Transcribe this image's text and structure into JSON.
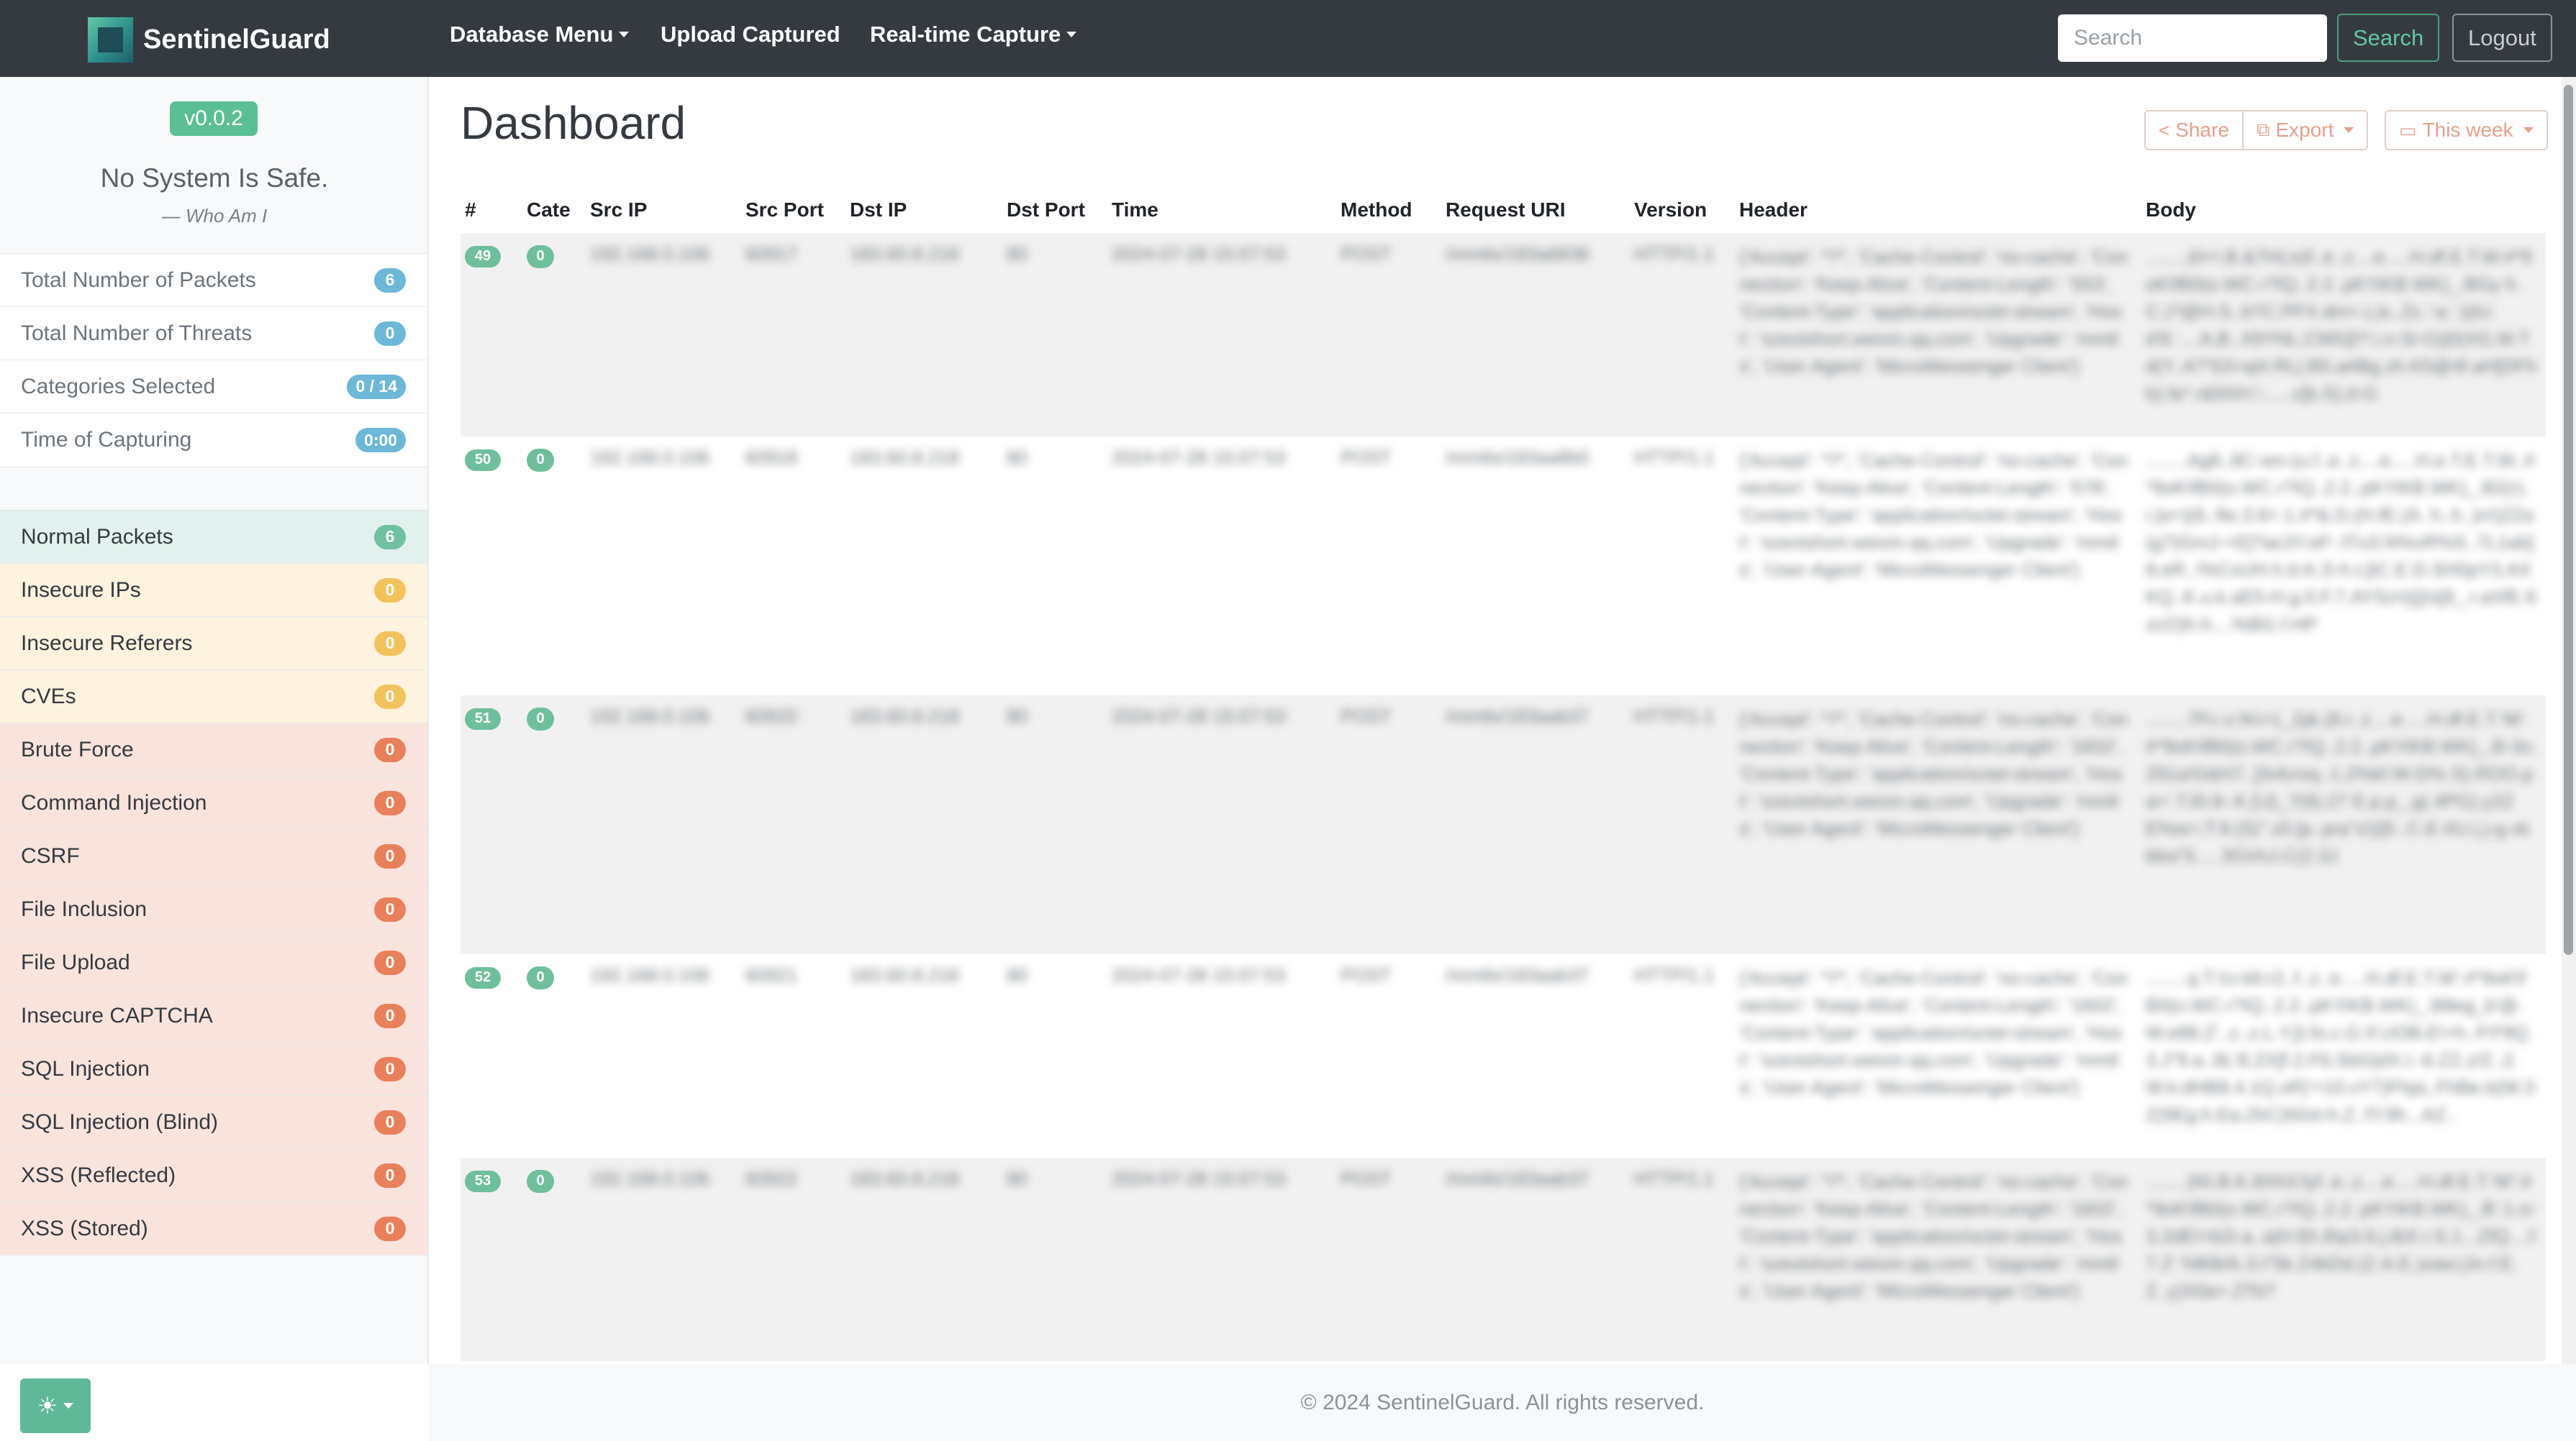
{
  "navbar": {
    "brand": "SentinelGuard",
    "menus": [
      {
        "label": "Database Menu",
        "dropdown": true
      },
      {
        "label": "Upload Captured",
        "dropdown": false
      },
      {
        "label": "Real-time Capture",
        "dropdown": true
      }
    ],
    "search_placeholder": "Search",
    "search_button": "Search",
    "logout_button": "Logout"
  },
  "sidebar": {
    "version": "v0.0.2",
    "motto": "No System Is Safe.",
    "motto_by": "— Who Am I",
    "stats": [
      {
        "label": "Total Number of Packets",
        "value": "6"
      },
      {
        "label": "Total Number of Threats",
        "value": "0"
      },
      {
        "label": "Categories Selected",
        "value": "0 / 14"
      },
      {
        "label": "Time of Capturing",
        "value": "0:00"
      }
    ],
    "categories": [
      {
        "label": "Normal Packets",
        "value": "6",
        "level": "safe"
      },
      {
        "label": "Insecure IPs",
        "value": "0",
        "level": "warn"
      },
      {
        "label": "Insecure Referers",
        "value": "0",
        "level": "warn"
      },
      {
        "label": "CVEs",
        "value": "0",
        "level": "warn"
      },
      {
        "label": "Brute Force",
        "value": "0",
        "level": "danger"
      },
      {
        "label": "Command Injection",
        "value": "0",
        "level": "danger"
      },
      {
        "label": "CSRF",
        "value": "0",
        "level": "danger"
      },
      {
        "label": "File Inclusion",
        "value": "0",
        "level": "danger"
      },
      {
        "label": "File Upload",
        "value": "0",
        "level": "danger"
      },
      {
        "label": "Insecure CAPTCHA",
        "value": "0",
        "level": "danger"
      },
      {
        "label": "SQL Injection",
        "value": "0",
        "level": "danger"
      },
      {
        "label": "SQL Injection (Blind)",
        "value": "0",
        "level": "danger"
      },
      {
        "label": "XSS (Reflected)",
        "value": "0",
        "level": "danger"
      },
      {
        "label": "XSS (Stored)",
        "value": "0",
        "level": "danger"
      }
    ],
    "theme_icon": "sun-icon"
  },
  "main": {
    "title": "Dashboard",
    "share_label": "Share",
    "export_label": "Export",
    "range_label": "This week",
    "columns": [
      "#",
      "Cate",
      "Src IP",
      "Src Port",
      "Dst IP",
      "Dst Port",
      "Time",
      "Method",
      "Request URI",
      "Version",
      "Header",
      "Body"
    ],
    "rows": [
      {
        "num": "49",
        "cate": "0",
        "src_ip": "192.168.0.106",
        "src_port": "60917",
        "dst_ip": "183.60.8.218",
        "dst_port": "80",
        "time": "2024-07-28 15:07:53",
        "method": "POST",
        "uri": "/mmtls/183a6838",
        "version": "HTTP/1.1",
        "header": "{'Accept': '*/*', 'Cache-Control': 'no-cache', 'Connection': 'Keep-Alive', 'Content-Length': '553', 'Content-Type': 'application/octet-stream', 'Host': 'szextshort.weixin.qq.com', 'Upgrade': 'mmtls', 'User-Agent': 'MicroMessenger Client'}",
        "body": "........)0+\\.B.&7H(;e)f..e..z....e.....H.df.E.T.W.#*9oK\\fB0(o.WC.r?IQ..2.2..pKYiKB.WK)_.BGy h.C.)?@H.S..b?C.PFX.dm+.L)s..Zc.':a.'.)(tU.d'8.'....A,B..X9YNL;CMG[I?.i.n-Si-G)|0(XG.M.Td(Y..A?'S3>a|#.RL|.B5.a#Bg.zh.K5@4f.aH[DFhb).fa*.r&9XH.!......c[b.S).d-G"
      },
      {
        "num": "50",
        "cate": "0",
        "src_ip": "192.168.0.106",
        "src_port": "60918",
        "dst_ip": "183.60.8.218",
        "dst_port": "80",
        "time": "2024-07-28 15:07:53",
        "method": "POST",
        "uri": "/mmtls/183aa8b0",
        "version": "HTTP/1.1",
        "header": "{'Accept': '*/*', 'Cache-Control': 'no-cache', 'Connection': 'Keep-Alive', 'Content-Length': '578', 'Content-Type': 'application/octet-stream', 'Host': 'szextshort.weixin.qq.com', 'Upgrade': 'mmtls', 'User-Agent': 'MicroMessenger Client'}",
        "body": "........Ag8.,8C-wn-(u.f..e..z....e.....H.e.T.E.T.W..#*9oK\\fB0(o.WC.r?IQ..2.2..pKYiKB.WK)_.B2(r).i.(e+)(6..fte.3.6+.1.#*&.D.(H.fE.(A. h..h..)n!)ZZa(g7)GmJ-+E]?ac3Y.eF-.f7u3.N%vR%S..7L1ab]8.eR..!%CxUH.h.tt.K,S-h.t.[tC.E.D.SH0pY3.AXKQ..K.u.k.aE5-H.g.0.F.7.AYSzVj{]/s[8_.r.aXfE.6zcO)h.h....%Bl1.f.HP"
      },
      {
        "num": "51",
        "cate": "0",
        "src_ip": "192.168.0.106",
        "src_port": "60920",
        "dst_ip": "183.60.8.218",
        "dst_port": "80",
        "time": "2024-07-28 15:07:53",
        "method": "POST",
        "uri": "/mmtls/183aab37",
        "version": "HTTP/1.1",
        "header": "{'Accept': '*/*', 'Cache-Control': 'no-cache', 'Connection': 'Keep-Alive', 'Content-Length': '1602', 'Content-Type': 'application/octet-stream', 'Host': 'szextshort.weixin.qq.com', 'Upgrade': 'mmtls', 'User-Agent': 'MicroMessenger Client'}",
        "body": "........7Fc.v;!Ki>1_2j&.(8.r..z....e.....H.df.E.T.'W'.#*9oK\\fB0(o.WC.r?IQ..2.2..pKYiKB.WK)_.B-3x;291a!G&H7..]3vfu!xq..1.2%kf.W-D%.S).ROO.pa>'.TJ0.8-.K.[\\J)_7(9).27 E.p.p_.g(.4PG).y2ZE%w>;T.9.(S)\".x0.[p..pra\"s!){E-.C.E-#U.(.j-g.vkbbs!'5.....3G\\rhJ.C(2.3J"
      },
      {
        "num": "52",
        "cate": "0",
        "src_ip": "192.168.0.106",
        "src_port": "60921",
        "dst_ip": "183.60.8.218",
        "dst_port": "80",
        "time": "2024-07-28 15:07:53",
        "method": "POST",
        "uri": "/mmtls/183aab37",
        "version": "HTTP/1.1",
        "header": "{'Accept': '*/*', 'Cache-Control': 'no-cache', 'Connection': 'Keep-Alive', 'Content-Length': '1602', 'Content-Type': 'application/octet-stream', 'Host': 'szextshort.weixin.qq.com', 'Upgrade': 'mmtls', 'User-Agent': 'MicroMessenger Client'}",
        "body": "........q.T.!cr.k6:r2..f..z..e.....H.df.E.T.W'.#*9oK\\fB0(o.WC.r?IQ..2.2..pKYiKB.WK)_.B8eg_b'@.W.e88.Z'..z..z.L.Y,[t.fo.c.G.\\f.UOB.E\\+h..P.F9Q.3.J\"9.a..8L'8.ZX[f.2.F6.SbG|dX.I.-6.ZZ.z/Z..2.W.k:dHB8.4.1Q.sR)'+10.vY7)FhpL.FhBe.b(W.3Z(9Eg.h.Ea.ZkC)50xt-h.Z..fY.9h...AZ.."
      },
      {
        "num": "53",
        "cate": "0",
        "src_ip": "192.168.0.106",
        "src_port": "60922",
        "dst_ip": "183.60.8.218",
        "dst_port": "80",
        "time": "2024-07-28 15:07:53",
        "method": "POST",
        "uri": "/mmtls/183aab37",
        "version": "HTTP/1.1",
        "header": "{'Accept': '*/*', 'Cache-Control': 'no-cache', 'Connection': 'Keep-Alive', 'Content-Length': '1602', 'Content-Type': 'application/octet-stream', 'Host': 'szextshort.weixin.qq.com', 'Upgrade': 'mmtls', 'User-Agent': 'MicroMessenger Client'}",
        "body": "........)N\\.B.K.8Xh3.fyf..e..z....e.....H.df.E.T.'W'.#*9oK\\fB0(o.WC.r?IQ..2.2..pKYiKB.WK)_.B'.1.cr3.2dEI>b2r.a..a|H.f(h.8\\p3.6.j.tbX.r.S.1...ZfQ....f7.2'.'h80b!k.3.t\"5k.Z4kDd.(Z.A.E.)xaw.|Jn.f.E.Z..y)X0a+.2Tb?"
      }
    ]
  },
  "footer": {
    "text": "© 2024 SentinelGuard. All rights reserved."
  }
}
